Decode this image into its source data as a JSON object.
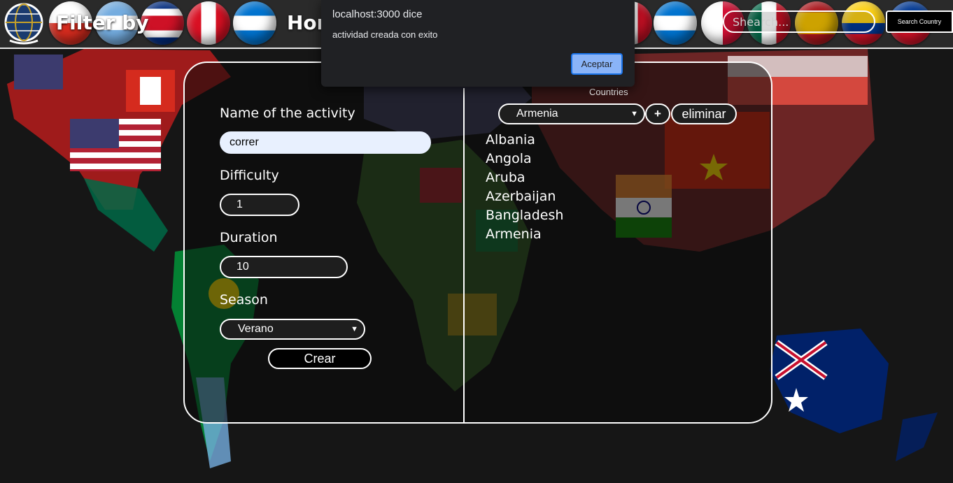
{
  "colors": {
    "accent": "#8ab4f8",
    "dialog_bg": "#202124",
    "card_border": "#ffffff",
    "autofill": "#e8f0fe"
  },
  "nav": {
    "brand": "Filter by",
    "home": "Hom",
    "search": {
      "placeholder": "Shearch...",
      "value": ""
    },
    "search_button": "Search Country",
    "logo_icon": "globe-icon"
  },
  "dialog": {
    "title": "localhost:3000 dice",
    "message": "actividad creada con exito",
    "ok_label": "Aceptar"
  },
  "form": {
    "name": {
      "label": "Name of the activity",
      "value": "correr"
    },
    "difficulty": {
      "label": "Difficulty",
      "value": "1"
    },
    "duration": {
      "label": "Duration",
      "value": "10"
    },
    "season": {
      "label": "Season",
      "value": "Verano"
    },
    "create_label": "Crear",
    "countries": {
      "label": "Countries",
      "selected": "Armenia",
      "add_label": "+",
      "remove_label": "eliminar",
      "items": [
        "Albania",
        "Angola",
        "Aruba",
        "Azerbaijan",
        "Bangladesh",
        "Armenia"
      ]
    }
  }
}
